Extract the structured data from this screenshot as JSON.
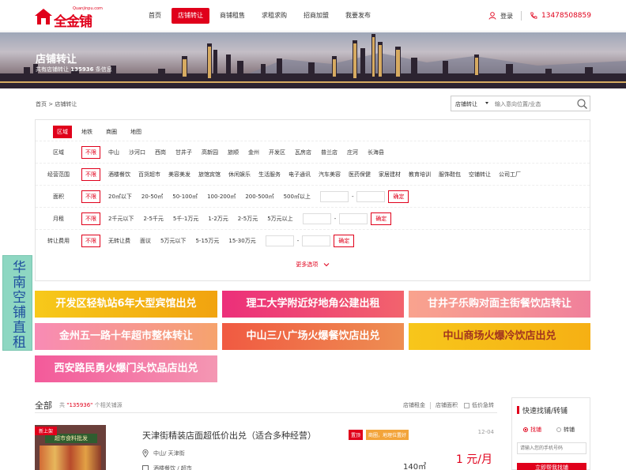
{
  "header": {
    "logo_text": "全金铺",
    "logo_sub": "Quanjinpu.com",
    "nav": [
      "首页",
      "店铺转让",
      "商铺租售",
      "求租求购",
      "招商加盟",
      "我要发布"
    ],
    "login": "登录",
    "phone": "13478508859"
  },
  "banner": {
    "title": "店铺转让",
    "count_prefix": "共有店铺转让",
    "count": "135936",
    "count_suffix": "条信息"
  },
  "breadcrumb": "首页 > 店铺转让",
  "search": {
    "category": "店铺转让",
    "placeholder": "输入意向位置/业态"
  },
  "filter": {
    "tabs": [
      "区域",
      "地铁",
      "商圈",
      "地图"
    ],
    "rows": [
      {
        "label": "区域",
        "options": [
          "不限",
          "中山",
          "沙河口",
          "西岗",
          "甘井子",
          "高新园",
          "旅顺",
          "金州",
          "开发区",
          "瓦房店",
          "普兰店",
          "庄河",
          "长海县"
        ]
      },
      {
        "label": "经营范围",
        "options": [
          "不限",
          "酒楼餐饮",
          "百货超市",
          "美容美发",
          "旅馆宾馆",
          "休闲娱乐",
          "生活服务",
          "电子通讯",
          "汽车美容",
          "医药保健",
          "家居建材",
          "教育培训",
          "服饰鞋包",
          "空铺转让",
          "公司工厂"
        ]
      },
      {
        "label": "面积",
        "options": [
          "不限",
          "20㎡以下",
          "20-50㎡",
          "50-100㎡",
          "100-200㎡",
          "200-500㎡",
          "500㎡以上"
        ],
        "range": true
      },
      {
        "label": "月租",
        "options": [
          "不限",
          "2千元以下",
          "2-5千元",
          "5千-1万元",
          "1-2万元",
          "2-5万元",
          "5万元以上"
        ],
        "range": true
      },
      {
        "label": "转让费用",
        "options": [
          "不限",
          "无转让费",
          "面议",
          "5万元以下",
          "5-15万元",
          "15-30万元"
        ],
        "range": true
      }
    ],
    "ok_label": "确定",
    "range_dash": "-",
    "more": "更多选项"
  },
  "sidefloat": {
    "text": "华南空铺直租"
  },
  "ads": [
    "开发区轻轨站6年大型宾馆出兑",
    "理工大学附近好地角公建出租",
    "甘井子乐购对面主街餐饮店转让",
    "金州五一路十年超市整体转让",
    "中山三八广场火爆餐饮店出兑",
    "中山商场火爆冷饮店出兑",
    "西安路民勇火爆门头饮品店出兑"
  ],
  "listing": {
    "all": "全部",
    "count_prefix": "共",
    "count": "\"135936\"",
    "count_suffix": "个相关铺源",
    "sorts": [
      "店铺租金",
      "店铺面积",
      "低价急转"
    ]
  },
  "item": {
    "tag": "新上架",
    "sign": "超市食料批发",
    "title": "天津街精装店面超低价出兑（适合多种经营）",
    "badge1": "置顶",
    "badge2": "商圈，地理位置好",
    "date": "12-04",
    "address": "中山/ 天津街",
    "type": "酒楼餐饮 / 超市",
    "area": "140㎡",
    "price": "1 元/月"
  },
  "quick": {
    "title": "快速找铺/转铺",
    "opt1": "找铺",
    "opt2": "转铺",
    "placeholder": "请输入您的手机号码",
    "button": "立即帮我找铺"
  }
}
